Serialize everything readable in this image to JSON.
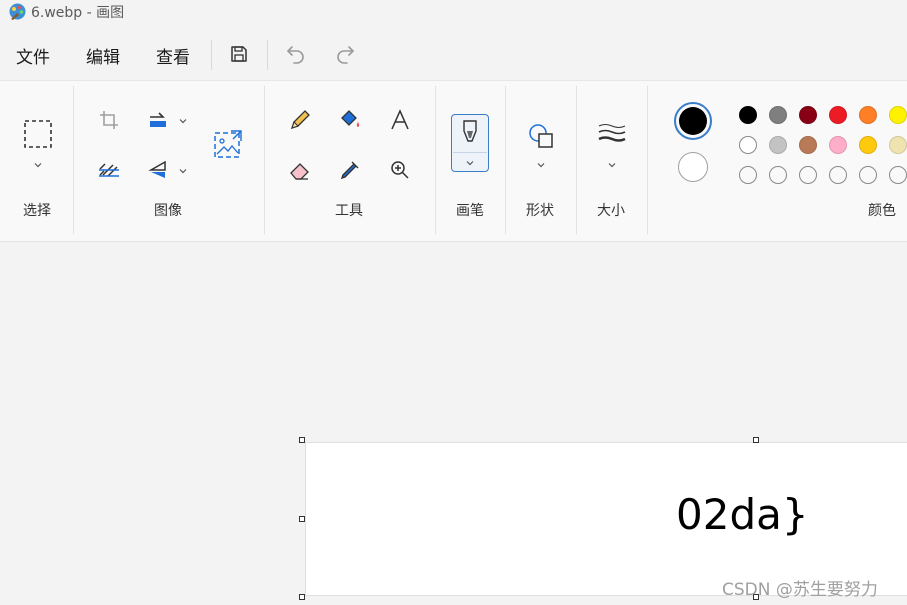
{
  "titlebar": {
    "title": "6.webp - 画图"
  },
  "menu": {
    "file": "文件",
    "edit": "编辑",
    "view": "查看"
  },
  "ribbon": {
    "groups": {
      "select": "选择",
      "image": "图像",
      "tools": "工具",
      "brush": "画笔",
      "shapes": "形状",
      "size": "大小",
      "colors": "颜色"
    }
  },
  "palette": {
    "primary": "#000000",
    "secondary": "#ffffff",
    "row1": [
      "#000000",
      "#7f7f7f",
      "#880015",
      "#ed1c24",
      "#ff7f27",
      "#fff200"
    ],
    "row2": [
      "#ffffff",
      "#c3c3c3",
      "#b97a57",
      "#ffaec9",
      "#ffc90e",
      "#efe4b0"
    ],
    "row3": [
      "empty",
      "empty",
      "empty",
      "empty",
      "empty",
      "empty"
    ]
  },
  "canvas": {
    "text": "02da}"
  },
  "watermark": "CSDN @苏生要努力"
}
